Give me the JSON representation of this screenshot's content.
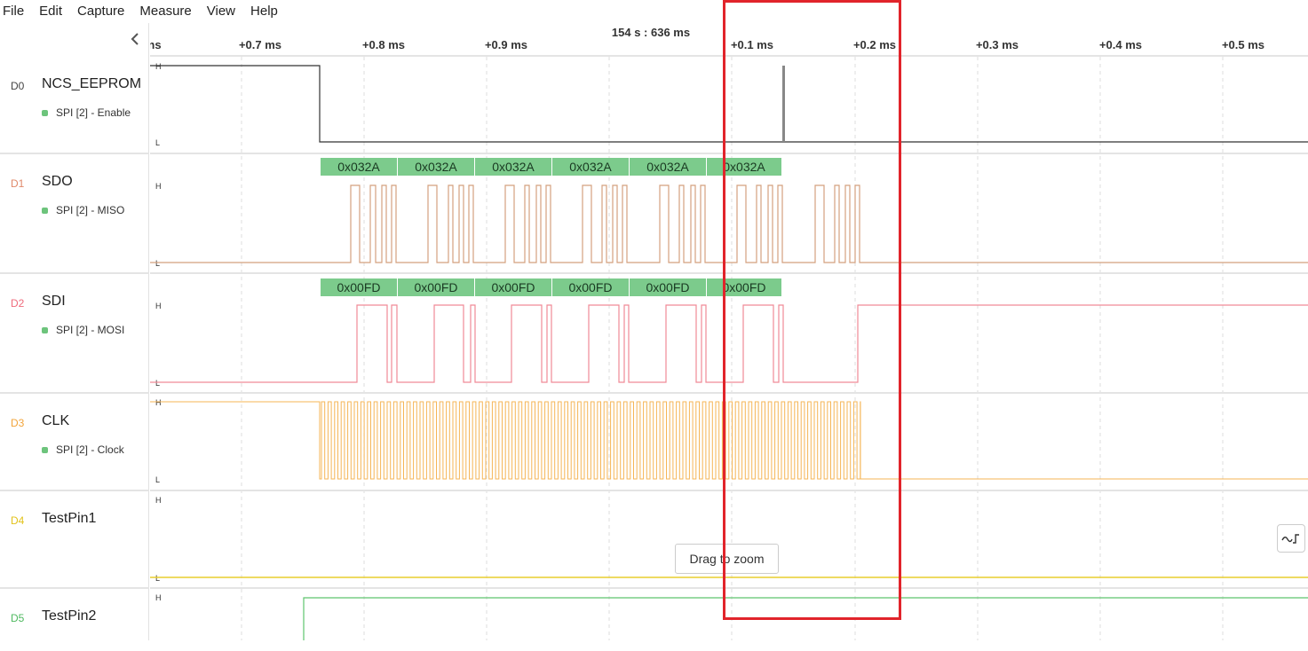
{
  "menu": [
    "File",
    "Edit",
    "Capture",
    "Measure",
    "View",
    "Help"
  ],
  "timeline": {
    "center_label": "154 s : 636 ms",
    "ticks": [
      "ns",
      "+0.7 ms",
      "+0.8 ms",
      "+0.9 ms",
      "+0.1 ms",
      "+0.2 ms",
      "+0.3 ms",
      "+0.4 ms",
      "+0.5 ms"
    ]
  },
  "channels": [
    {
      "id": "D0",
      "name": "NCS_EEPROM",
      "analyzer": "SPI [2] - Enable",
      "color": "#333333"
    },
    {
      "id": "D1",
      "name": "SDO",
      "analyzer": "SPI [2] - MISO",
      "color": "#d4a07e"
    },
    {
      "id": "D2",
      "name": "SDI",
      "analyzer": "SPI [2] - MOSI",
      "color": "#f08a96"
    },
    {
      "id": "D3",
      "name": "CLK",
      "analyzer": "SPI [2] - Clock",
      "color": "#f5b556"
    },
    {
      "id": "D4",
      "name": "TestPin1",
      "analyzer": "",
      "color": "#e9cd2e"
    },
    {
      "id": "D5",
      "name": "TestPin2",
      "analyzer": "",
      "color": "#5ec46e"
    }
  ],
  "level_labels": {
    "high": "H",
    "low": "L"
  },
  "decodes": {
    "miso": [
      "0x032A",
      "0x032A",
      "0x032A",
      "0x032A",
      "0x032A",
      "0x032A"
    ],
    "mosi": [
      "0x00FD",
      "0x00FD",
      "0x00FD",
      "0x00FD",
      "0x00FD",
      "0x00FD"
    ]
  },
  "decode_color": "#7ccb8c",
  "highlight_color": "#e1242b",
  "drag_zoom_label": "Drag to zoom",
  "icons": {
    "collapse": "chevron-left-icon",
    "float": "signal-edge-icon"
  }
}
